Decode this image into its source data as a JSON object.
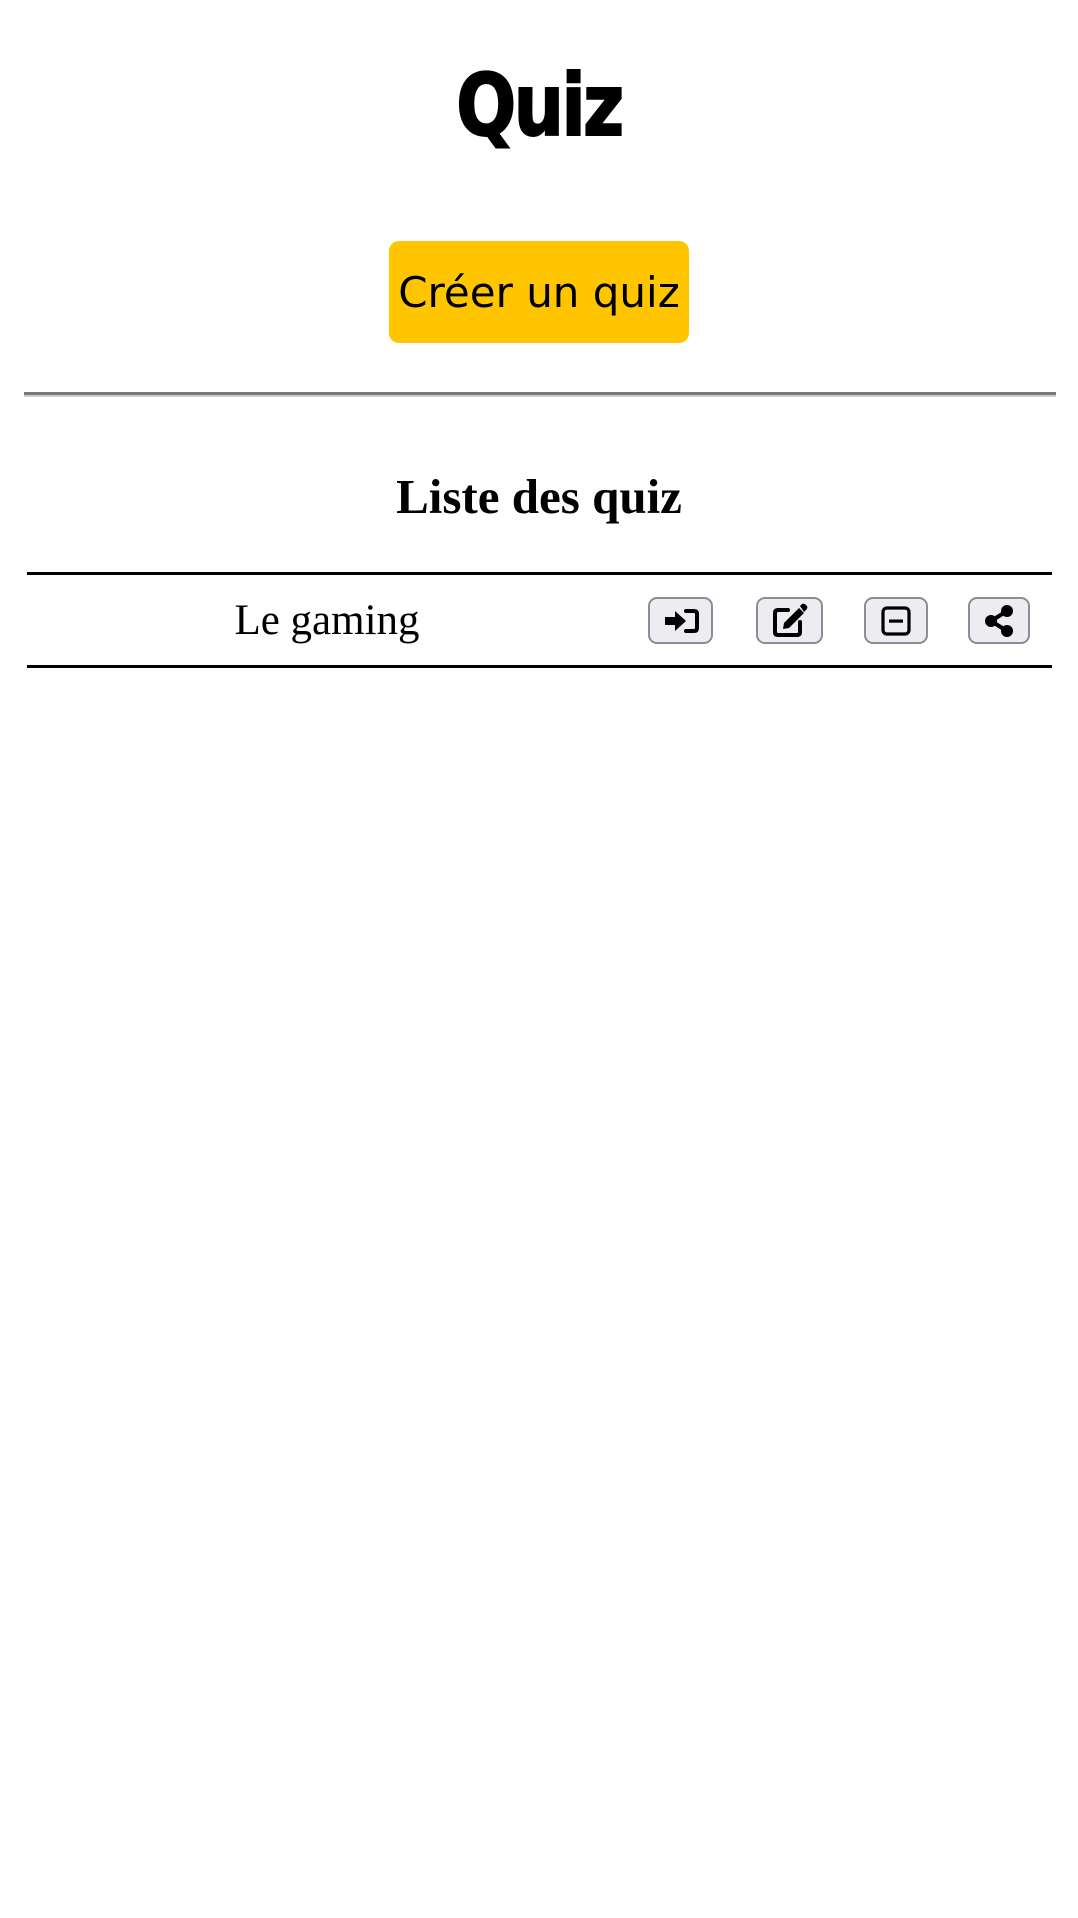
{
  "header": {
    "title": "Quiz",
    "create_button_label": "Créer un quiz"
  },
  "list": {
    "heading": "Liste des quiz",
    "quizzes": [
      {
        "name": "Le gaming",
        "actions": [
          "enter-icon",
          "edit-icon",
          "delete-icon",
          "share-icon"
        ]
      }
    ]
  },
  "colors": {
    "accent": "#ffc600",
    "icon_button_bg": "#ececf1",
    "icon_button_border": "#8c8c96"
  }
}
